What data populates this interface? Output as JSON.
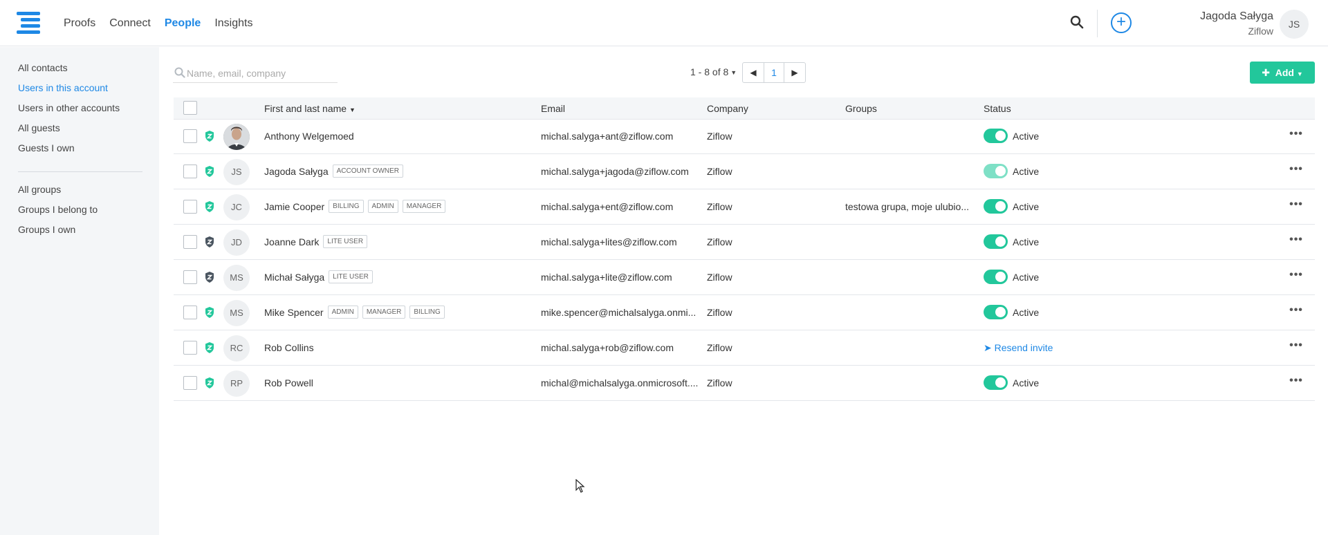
{
  "nav": {
    "items": [
      {
        "label": "Proofs",
        "active": false
      },
      {
        "label": "Connect",
        "active": false
      },
      {
        "label": "People",
        "active": true
      },
      {
        "label": "Insights",
        "active": false
      }
    ]
  },
  "user": {
    "name": "Jagoda Sałyga",
    "org": "Ziflow",
    "initials": "JS"
  },
  "sidebar": {
    "contacts": [
      "All contacts",
      "Users in this account",
      "Users in other accounts",
      "All guests",
      "Guests I own"
    ],
    "groups": [
      "All groups",
      "Groups I belong to",
      "Groups I own"
    ],
    "active": "Users in this account"
  },
  "toolbar": {
    "search_placeholder": "Name, email, company",
    "pager_range": "1 - 8 of 8",
    "page": "1",
    "add_label": "Add"
  },
  "table": {
    "headers": {
      "name": "First and last name",
      "email": "Email",
      "company": "Company",
      "groups": "Groups",
      "status": "Status"
    },
    "rows": [
      {
        "initials": "",
        "photo": true,
        "name": "Anthony Welgemoed",
        "badges": [],
        "email": "michal.salyga+ant@ziflow.com",
        "company": "Ziflow",
        "groups": "",
        "status": "Active",
        "shield": "green",
        "toggle": "on"
      },
      {
        "initials": "JS",
        "photo": false,
        "name": "Jagoda Sałyga",
        "badges": [
          "ACCOUNT OWNER"
        ],
        "email": "michal.salyga+jagoda@ziflow.com",
        "company": "Ziflow",
        "groups": "",
        "status": "Active",
        "shield": "green",
        "toggle": "light"
      },
      {
        "initials": "JC",
        "photo": false,
        "name": "Jamie Cooper",
        "badges": [
          "BILLING",
          "ADMIN",
          "MANAGER"
        ],
        "email": "michal.salyga+ent@ziflow.com",
        "company": "Ziflow",
        "groups": "testowa grupa, moje ulubio...",
        "status": "Active",
        "shield": "green",
        "toggle": "on"
      },
      {
        "initials": "JD",
        "photo": false,
        "name": "Joanne Dark",
        "badges": [
          "LITE USER"
        ],
        "email": "michal.salyga+lites@ziflow.com",
        "company": "Ziflow",
        "groups": "",
        "status": "Active",
        "shield": "dark",
        "toggle": "on"
      },
      {
        "initials": "MS",
        "photo": false,
        "name": "Michał Sałyga",
        "badges": [
          "LITE USER"
        ],
        "email": "michal.salyga+lite@ziflow.com",
        "company": "Ziflow",
        "groups": "",
        "status": "Active",
        "shield": "dark",
        "toggle": "on"
      },
      {
        "initials": "MS",
        "photo": false,
        "name": "Mike Spencer",
        "badges": [
          "ADMIN",
          "MANAGER",
          "BILLING"
        ],
        "email": "mike.spencer@michalsalyga.onmi...",
        "company": "Ziflow",
        "groups": "",
        "status": "Active",
        "shield": "green",
        "toggle": "on"
      },
      {
        "initials": "RC",
        "photo": false,
        "name": "Rob Collins",
        "badges": [],
        "email": "michal.salyga+rob@ziflow.com",
        "company": "Ziflow",
        "groups": "",
        "status": "Resend invite",
        "shield": "green",
        "toggle": "none"
      },
      {
        "initials": "RP",
        "photo": false,
        "name": "Rob Powell",
        "badges": [],
        "email": "michal@michalsalyga.onmicrosoft....",
        "company": "Ziflow",
        "groups": "",
        "status": "Active",
        "shield": "green",
        "toggle": "on"
      }
    ]
  },
  "colors": {
    "accent": "#1e88e5",
    "success": "#22c79b",
    "shield_dark": "#4a5560"
  }
}
